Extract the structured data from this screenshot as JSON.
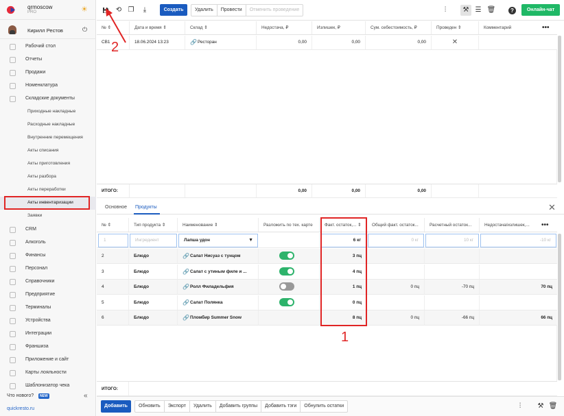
{
  "brand": {
    "name": "qrmoscow",
    "tier": "PRO"
  },
  "user": {
    "name": "Кирилл Рестов"
  },
  "nav": {
    "desktop": "Рабочий стол",
    "reports": "Отчеты",
    "sales": "Продажи",
    "nomenclature": "Номенклатура",
    "warehouse": "Складские документы",
    "sub": {
      "incoming": "Приходные накладные",
      "outgoing": "Расходные накладные",
      "internal": "Внутренние перемещения",
      "writeoff": "Акты списания",
      "cooking": "Акты приготовления",
      "disassembly": "Акты разбора",
      "processing": "Акты переработки",
      "inventory": "Акты инвентаризации",
      "requests": "Заявки"
    },
    "crm": "CRM",
    "alcohol": "Алкоголь",
    "finance": "Финансы",
    "staff": "Персонал",
    "references": "Справочники",
    "company": "Предприятие",
    "terminals": "Терминалы",
    "devices": "Устройства",
    "integrations": "Интеграции",
    "franchise": "Франшиза",
    "app": "Приложение и сайт",
    "loyalty": "Карты лояльности",
    "templates": "Шаблонизатор чека"
  },
  "whats_new": "Что нового?",
  "new_badge": "NEW",
  "site": "quickresto.ru",
  "toolbar": {
    "create": "Создать",
    "delete": "Удалить",
    "post": "Провести",
    "cancel_post": "Отменить проведение",
    "online_chat": "Онлайн-чат"
  },
  "top_table": {
    "headers": [
      "№",
      "Дата и время",
      "Склад",
      "Недостача, ₽",
      "Излишек, ₽",
      "Сум. себестоимость, ₽",
      "Проведен",
      "Комментарий"
    ],
    "row": {
      "num": "СВ1",
      "date": "18.06.2024 13:23",
      "warehouse": "Ресторан",
      "shortage": "0,00",
      "surplus": "0,00",
      "cost": "0,00",
      "posted": "✕",
      "comment": ""
    },
    "total_label": "ИТОГО:",
    "totals": {
      "shortage": "0,00",
      "surplus": "0,00",
      "cost": "0,00"
    }
  },
  "tabs": {
    "main": "Основное",
    "products": "Продукты"
  },
  "bottom_table": {
    "headers": [
      "№",
      "Тип продукта",
      "Наименование",
      "Разложить по тех. карте",
      "Факт. остаток,...",
      "Общий факт. остаток...",
      "Расчетный остаток...",
      "Недостача/излишек,..."
    ],
    "edit_row": {
      "num": "1",
      "type_placeholder": "Ингредиент",
      "name": "Лапша удон",
      "fact": "6 кг",
      "total_fact": "0 кг",
      "calc": "10 кг",
      "diff": "-10 кг"
    },
    "rows": [
      {
        "num": "2",
        "type": "Блюдо",
        "name": "Салат Нисуаз с тунцом",
        "split": true,
        "fact": "3 пц",
        "total": "",
        "calc": "",
        "diff": ""
      },
      {
        "num": "3",
        "type": "Блюдо",
        "name": "Салат с утиным филе и ...",
        "split": true,
        "fact": "4 пц",
        "total": "",
        "calc": "",
        "diff": ""
      },
      {
        "num": "4",
        "type": "Блюдо",
        "name": "Ролл Филадельфия",
        "split": false,
        "fact": "1 пц",
        "total": "0 пц",
        "calc": "-70 пц",
        "diff": "70 пц"
      },
      {
        "num": "5",
        "type": "Блюдо",
        "name": "Салат Полянка",
        "split": true,
        "fact": "0 пц",
        "total": "",
        "calc": "",
        "diff": ""
      },
      {
        "num": "6",
        "type": "Блюдо",
        "name": "Пломбир Summer Snow",
        "split": null,
        "fact": "8 пц",
        "total": "0 пц",
        "calc": "-66 пц",
        "diff": "66 пц"
      }
    ],
    "total_label": "ИТОГО:"
  },
  "bottom_toolbar": {
    "add": "Добавить",
    "refresh": "Обновить",
    "export": "Экспорт",
    "delete": "Удалить",
    "add_groups": "Добавить группы",
    "add_tags": "Добавить тэги",
    "reset": "Обнулить остатки"
  },
  "annotations": {
    "one": "1",
    "two": "2"
  },
  "colors": {
    "primary": "#1a5bbf",
    "green": "#1fb866",
    "toggle_on": "#2db36b",
    "annotation": "#e02424"
  }
}
